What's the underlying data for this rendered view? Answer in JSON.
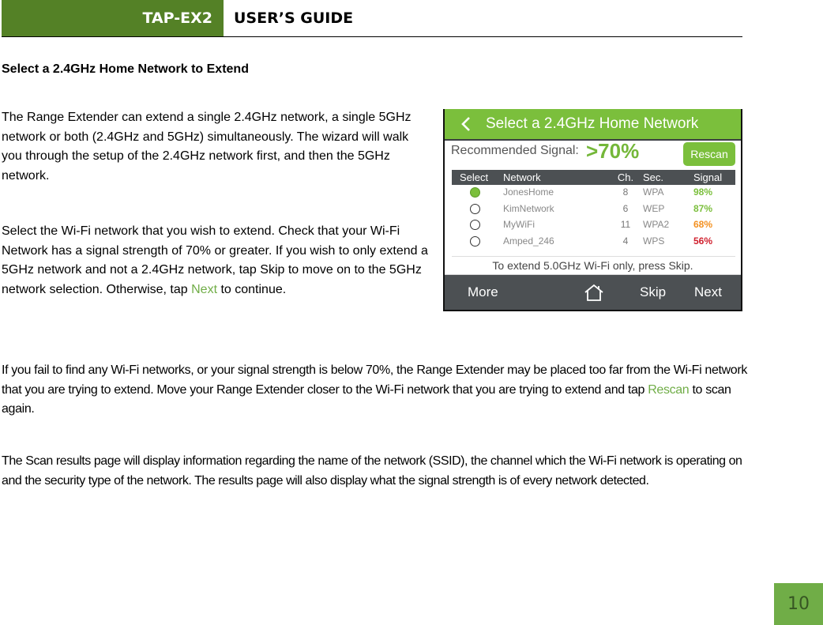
{
  "header": {
    "product": "TAP-EX2",
    "title": "USER’S GUIDE",
    "brand_color": "#548126"
  },
  "section": {
    "heading": "Select a 2.4GHz Home Network to Extend",
    "p1": "The Range Extender can extend a single 2.4GHz network, a single 5GHz network or both (2.4GHz and 5GHz) simultaneously.  The wizard will walk you through the setup of the 2.4GHz network first, and then the 5GHz network.",
    "p2_before": "Select the Wi-Fi network that you wish to extend.  Check that your Wi-Fi Network has a signal strength of 70% or greater. If you wish to only extend a 5GHz network and not a 2.4GHz network, tap Skip to move on to the 5GHz network selection. Otherwise, tap ",
    "p2_link": "Next",
    "p2_after": " to continue.",
    "p3_before": "If you fail to find any Wi-Fi networks, or your signal strength is below 70%, the Range Extender may be placed too far from the Wi-Fi network that you are trying to extend. Move your Range Extender closer to the Wi-Fi network that you are trying to extend and tap ",
    "p3_link": "Rescan",
    "p3_after": " to scan again.",
    "p4": "The Scan results page will display information regarding the name of the network (SSID), the channel which the Wi-Fi network is operating on and the security type of the network. The results page will also display what the signal strength is of every network detected.",
    "link_color": "#70ad47"
  },
  "device": {
    "title": "Select a 2.4GHz Home Network",
    "back_icon": "chevron-left-icon",
    "recommended_label": "Recommended Signal:",
    "recommended_value": ">70%",
    "rescan_label": "Rescan",
    "columns": [
      "Select",
      "Network",
      "Ch.",
      "Sec.",
      "Signal"
    ],
    "networks": [
      {
        "selected": true,
        "name": "JonesHome",
        "channel": "8",
        "security": "WPA",
        "signal": "98%",
        "signal_color": "#7bbf3c"
      },
      {
        "selected": false,
        "name": "KimNetwork",
        "channel": "6",
        "security": "WEP",
        "signal": "87%",
        "signal_color": "#7bbf3c"
      },
      {
        "selected": false,
        "name": "MyWiFi",
        "channel": "11",
        "security": "WPA2",
        "signal": "68%",
        "signal_color": "#f39020"
      },
      {
        "selected": false,
        "name": "Amped_246",
        "channel": "4",
        "security": "WPS",
        "signal": "56%",
        "signal_color": "#d0202e"
      }
    ],
    "hint": "To extend 5.0GHz Wi-Fi only, press Skip.",
    "footer": {
      "more": "More",
      "home_icon": "home-icon",
      "skip": "Skip",
      "next": "Next"
    },
    "accent_color": "#7bbf3c"
  },
  "page_number": "10"
}
